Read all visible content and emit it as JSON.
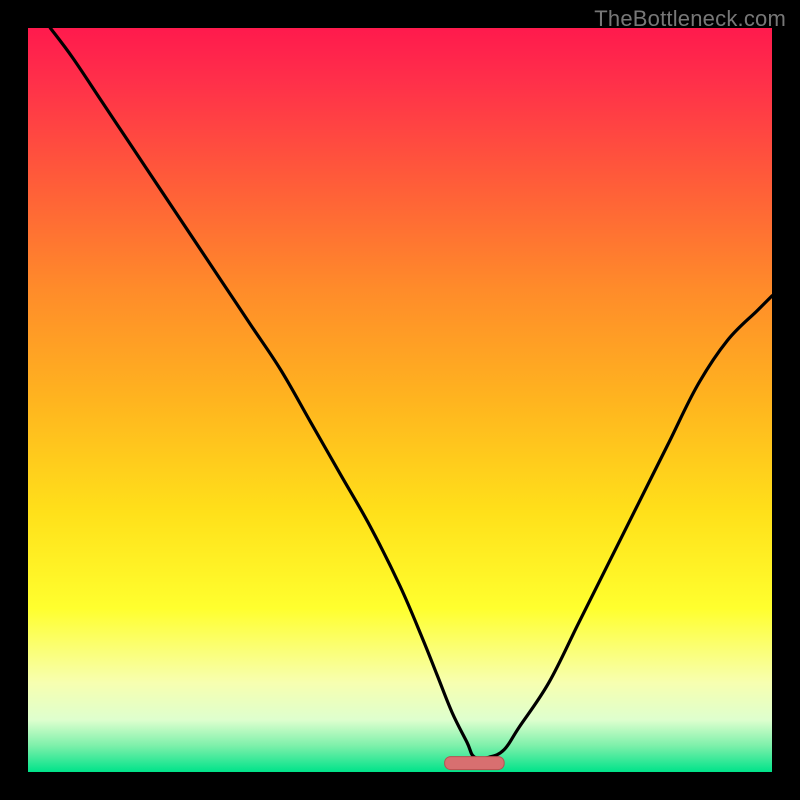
{
  "watermark": "TheBottleneck.com",
  "colors": {
    "frame": "#000000",
    "curve": "#000000",
    "gradient_stops": [
      {
        "offset": 0.0,
        "color": "#ff1a4d"
      },
      {
        "offset": 0.07,
        "color": "#ff2f4a"
      },
      {
        "offset": 0.2,
        "color": "#ff5a3a"
      },
      {
        "offset": 0.35,
        "color": "#ff8b2a"
      },
      {
        "offset": 0.5,
        "color": "#ffb41f"
      },
      {
        "offset": 0.65,
        "color": "#ffe01a"
      },
      {
        "offset": 0.78,
        "color": "#ffff2e"
      },
      {
        "offset": 0.88,
        "color": "#f7ffb0"
      },
      {
        "offset": 0.93,
        "color": "#deffce"
      },
      {
        "offset": 0.965,
        "color": "#7cf0aa"
      },
      {
        "offset": 1.0,
        "color": "#00e38a"
      }
    ],
    "marker_fill": "#d86f70",
    "marker_stroke": "#b85050"
  },
  "chart_data": {
    "type": "line",
    "title": "",
    "xlabel": "",
    "ylabel": "",
    "xlim": [
      0,
      100
    ],
    "ylim": [
      0,
      100
    ],
    "grid": false,
    "series": [
      {
        "name": "bottleneck-curve",
        "x": [
          3,
          6,
          10,
          14,
          18,
          22,
          26,
          30,
          34,
          38,
          42,
          46,
          50,
          53,
          55,
          57,
          59,
          60,
          62,
          64,
          66,
          70,
          74,
          78,
          82,
          86,
          90,
          94,
          98,
          100
        ],
        "values": [
          100,
          96,
          90,
          84,
          78,
          72,
          66,
          60,
          54,
          47,
          40,
          33,
          25,
          18,
          13,
          8,
          4,
          2,
          2,
          3,
          6,
          12,
          20,
          28,
          36,
          44,
          52,
          58,
          62,
          64
        ]
      }
    ],
    "marker": {
      "name": "optimal-range",
      "x_start": 56,
      "x_end": 64,
      "y": 1.2
    }
  }
}
